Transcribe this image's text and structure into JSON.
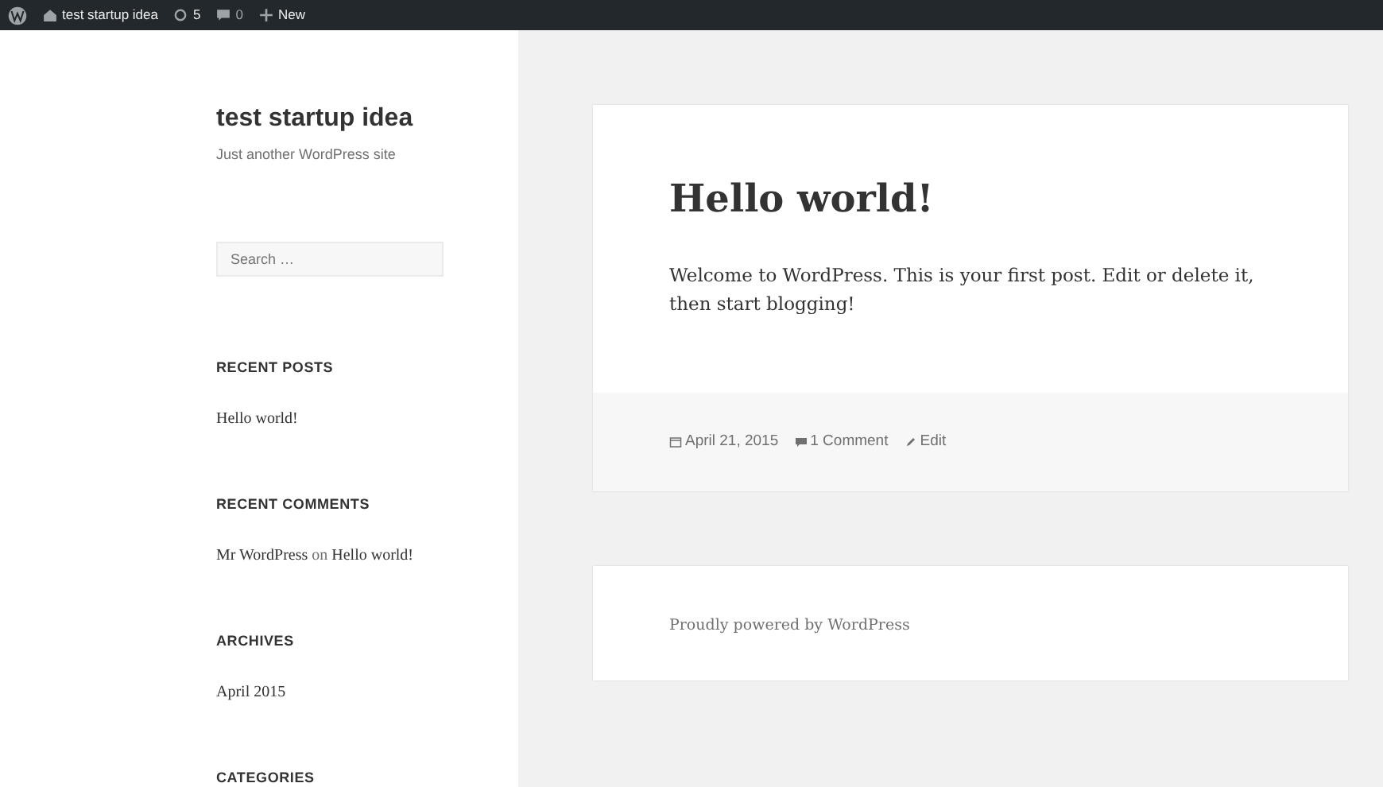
{
  "admin_bar": {
    "site": "test startup idea",
    "updates": "5",
    "comments": "0",
    "new": "New"
  },
  "sidebar": {
    "site_title": "test startup idea",
    "tagline": "Just another WordPress site",
    "search": {
      "placeholder": "Search …"
    },
    "widgets": [
      {
        "title": "RECENT POSTS",
        "kind": "links",
        "items": [
          "Hello world!"
        ]
      },
      {
        "title": "RECENT COMMENTS",
        "kind": "comment",
        "author": "Mr WordPress",
        "joiner": "on",
        "post": "Hello world!"
      },
      {
        "title": "ARCHIVES",
        "kind": "links",
        "items": [
          "April 2015"
        ]
      },
      {
        "title": "CATEGORIES",
        "kind": "links"
      }
    ]
  },
  "post": {
    "title": "Hello world!",
    "body": "Welcome to WordPress. This is your first post. Edit or delete it, then start blogging!",
    "date": "April 21, 2015",
    "comments": "1 Comment",
    "edit": "Edit"
  },
  "footer": {
    "text": "Proudly powered by WordPress"
  }
}
